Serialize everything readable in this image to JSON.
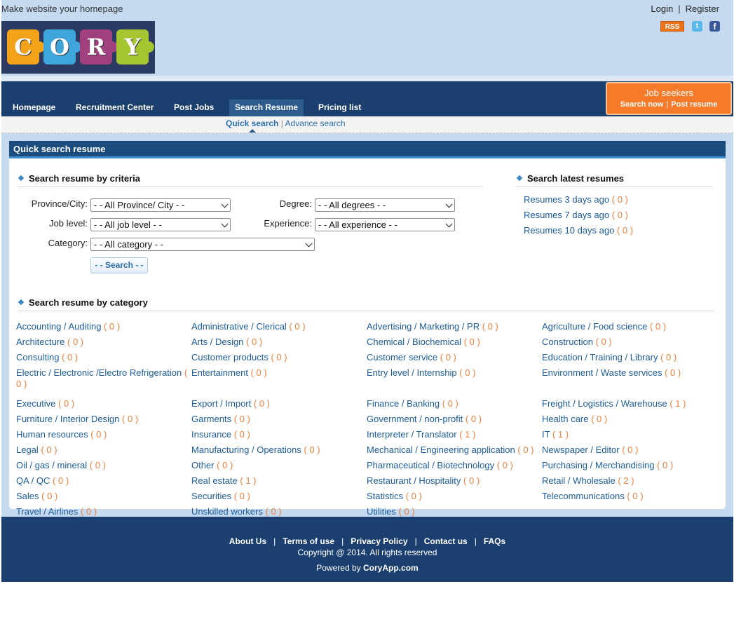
{
  "topbar": {
    "tagline": "Make website your homepage",
    "login": "Login",
    "separator": "|",
    "register": "Register"
  },
  "logo": {
    "letters": [
      "C",
      "O",
      "R",
      "Y"
    ],
    "colors": [
      "#f2a31a",
      "#3fa6dc",
      "#a1407f",
      "#a6c631"
    ]
  },
  "social": {
    "rss": "RSS",
    "twitter_icon": "twitter-icon",
    "facebook_icon": "facebook-icon"
  },
  "nav": {
    "items": [
      "Homepage",
      "Recruitment Center",
      "Post Jobs",
      "Search Resume",
      "Pricing list"
    ],
    "active": "Search Resume"
  },
  "job_seekers": {
    "title": "Job seekers",
    "search_now": "Search now",
    "separator": "|",
    "post_resume": "Post resume"
  },
  "subnav": {
    "quick": "Quick search",
    "separator": "|",
    "advance": "Advance search"
  },
  "panel": {
    "title": "Quick search resume"
  },
  "criteria": {
    "title": "Search resume by criteria",
    "province_label": "Province/City:",
    "province_value": "- - All Province/ City - -",
    "degree_label": "Degree:",
    "degree_value": "- - All degrees - -",
    "job_level_label": "Job level:",
    "job_level_value": "- - All job level - -",
    "experience_label": "Experience:",
    "experience_value": "- - All experience - -",
    "category_label": "Category:",
    "category_value": "- - All category - -",
    "search_button": "- - Search - -"
  },
  "latest": {
    "title": "Search latest resumes",
    "items": [
      {
        "label": "Resumes 3 days ago",
        "count": "( 0 )"
      },
      {
        "label": "Resumes 7 days ago",
        "count": "( 0 )"
      },
      {
        "label": "Resumes 10 days ago",
        "count": "( 0 )"
      }
    ]
  },
  "categories": {
    "title": "Search resume by category",
    "items": [
      {
        "label": "Accounting / Auditing",
        "count": "( 0 )"
      },
      {
        "label": "Administrative / Clerical",
        "count": "( 0 )"
      },
      {
        "label": "Advertising / Marketing / PR",
        "count": "( 0 )"
      },
      {
        "label": "Agriculture / Food science",
        "count": "( 0 )"
      },
      {
        "label": "Architecture",
        "count": "( 0 )"
      },
      {
        "label": "Arts / Design",
        "count": "( 0 )"
      },
      {
        "label": "Chemical / Biochemical",
        "count": "( 0 )"
      },
      {
        "label": "Construction",
        "count": "( 0 )"
      },
      {
        "label": "Consulting",
        "count": "( 0 )"
      },
      {
        "label": "Customer products",
        "count": "( 0 )"
      },
      {
        "label": "Customer service",
        "count": "( 0 )"
      },
      {
        "label": "Education / Training / Library",
        "count": "( 0 )"
      },
      {
        "label": "Electric / Electronic /Electro Refrigeration",
        "count": "( 0 )"
      },
      {
        "label": "Entertainment",
        "count": "( 0 )"
      },
      {
        "label": "Entry level / Internship",
        "count": "( 0 )"
      },
      {
        "label": "Environment / Waste services",
        "count": "( 0 )"
      },
      {
        "label": "Executive",
        "count": "( 0 )"
      },
      {
        "label": "Export / Import",
        "count": "( 0 )"
      },
      {
        "label": "Finance / Banking",
        "count": "( 0 )"
      },
      {
        "label": "Freight / Logistics / Warehouse",
        "count": "( 1 )"
      },
      {
        "label": "Furniture / Interior Design",
        "count": "( 0 )"
      },
      {
        "label": "Garments",
        "count": "( 0 )"
      },
      {
        "label": "Government / non-profit",
        "count": "( 0 )"
      },
      {
        "label": "Health care",
        "count": "( 0 )"
      },
      {
        "label": "Human resources",
        "count": "( 0 )"
      },
      {
        "label": "Insurance",
        "count": "( 0 )"
      },
      {
        "label": "Interpreter / Translator",
        "count": "( 1 )"
      },
      {
        "label": "IT",
        "count": "( 1 )"
      },
      {
        "label": "Legal",
        "count": "( 0 )"
      },
      {
        "label": "Manufacturing / Operations",
        "count": "( 0 )"
      },
      {
        "label": "Mechanical / Engineering application",
        "count": "( 0 )"
      },
      {
        "label": "Newspaper / Editor",
        "count": "( 0 )"
      },
      {
        "label": "Oil / gas / mineral",
        "count": "( 0 )"
      },
      {
        "label": "Other",
        "count": "( 0 )"
      },
      {
        "label": "Pharmaceutical / Biotechnology",
        "count": "( 0 )"
      },
      {
        "label": "Purchasing / Merchandising",
        "count": "( 0 )"
      },
      {
        "label": "QA / QC",
        "count": "( 0 )"
      },
      {
        "label": "Real estate",
        "count": "( 1 )"
      },
      {
        "label": "Restaurant / Hospitality",
        "count": "( 0 )"
      },
      {
        "label": "Retail / Wholesale",
        "count": "( 2 )"
      },
      {
        "label": "Sales",
        "count": "( 0 )"
      },
      {
        "label": "Securities",
        "count": "( 0 )"
      },
      {
        "label": "Statistics",
        "count": "( 0 )"
      },
      {
        "label": "Telecommunications",
        "count": "( 0 )"
      },
      {
        "label": "Travel / Airlines",
        "count": "( 0 )"
      },
      {
        "label": "Unskilled workers",
        "count": "( 0 )"
      },
      {
        "label": "Utilities",
        "count": "( 0 )"
      }
    ]
  },
  "footer": {
    "links": [
      "About Us",
      "Terms of use",
      "Privacy Policy",
      "Contact us",
      "FAQs"
    ],
    "separator": "|",
    "copyright": "Copyright @ 2014. All rights reserved",
    "powered_prefix": "Powered by",
    "powered_name": "CoryApp.com"
  },
  "colors": {
    "nav_bg": "#1b3f6e",
    "header_bg": "#c6daef",
    "accent_orange": "#f57a2a",
    "link_blue": "#1d5c99",
    "count_orange": "#f07f3a"
  }
}
